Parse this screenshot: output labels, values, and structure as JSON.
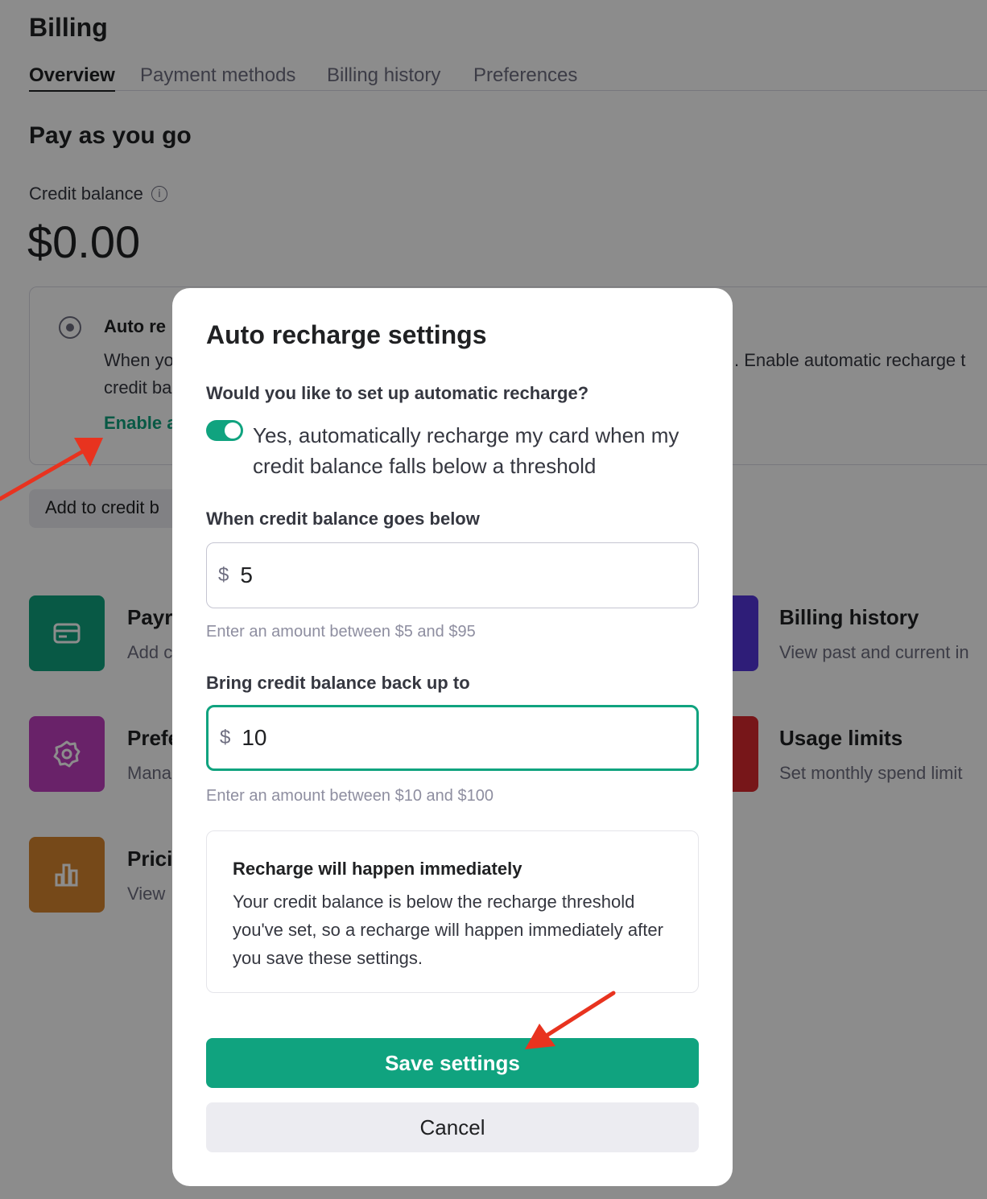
{
  "page": {
    "title": "Billing",
    "tabs": [
      {
        "label": "Overview",
        "active": true
      },
      {
        "label": "Payment methods",
        "active": false
      },
      {
        "label": "Billing history",
        "active": false
      },
      {
        "label": "Preferences",
        "active": false
      }
    ],
    "section_title": "Pay as you go",
    "credit_label": "Credit balance",
    "credit_amount": "$0.00",
    "auto_card": {
      "title": "Auto re",
      "desc_line1": "When yo",
      "desc_line2": "credit ba",
      "desc_right": ". Enable automatic recharge t",
      "enable_link": "Enable a"
    },
    "add_credit_button": "Add to credit b",
    "tiles": [
      {
        "title": "Payr",
        "subtitle": "Add c",
        "color": "#10a37f",
        "icon": "card-icon"
      },
      {
        "title": "Prefe",
        "subtitle": "Mana",
        "color": "#bf3fbf",
        "icon": "gear-icon"
      },
      {
        "title": "Prici",
        "subtitle": "View",
        "color": "#d8852e",
        "icon": "chart-icon"
      },
      {
        "title": "Billing history",
        "subtitle": "View past and current in",
        "color": "#5436da",
        "icon": "history-icon"
      },
      {
        "title": "Usage limits",
        "subtitle": "Set monthly spend limit",
        "color": "#d9282f",
        "icon": "limits-icon"
      }
    ]
  },
  "modal": {
    "title": "Auto recharge settings",
    "question": "Would you like to set up automatic recharge?",
    "toggle_on": true,
    "toggle_text": "Yes, automatically recharge my card when my credit balance falls below a threshold",
    "threshold_label": "When credit balance goes below",
    "threshold_currency": "$",
    "threshold_value": "5",
    "threshold_hint": "Enter an amount between $5 and $95",
    "target_label": "Bring credit balance back up to",
    "target_currency": "$",
    "target_value": "10",
    "target_hint": "Enter an amount between $10 and $100",
    "notice_title": "Recharge will happen immediately",
    "notice_body": "Your credit balance is below the recharge threshold you've set, so a recharge will happen immediately after you save these settings.",
    "save_button": "Save settings",
    "cancel_button": "Cancel"
  },
  "colors": {
    "accent": "#10a37f",
    "annotation_arrow": "#e8331f"
  }
}
